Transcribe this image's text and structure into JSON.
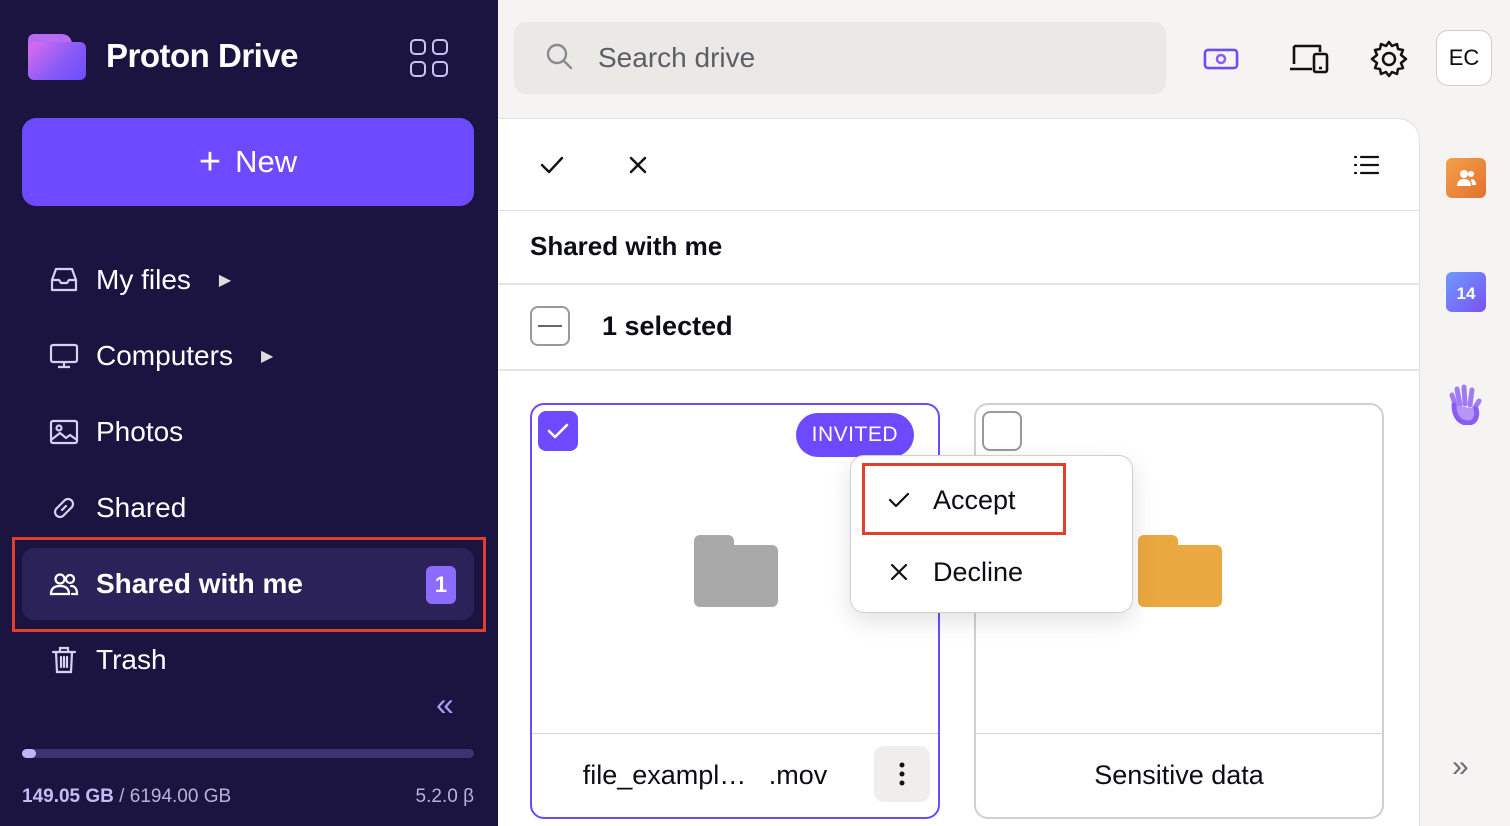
{
  "app": {
    "name": "Proton Drive"
  },
  "sidebar": {
    "new_button": {
      "plus": "+",
      "label": "New"
    },
    "items": [
      {
        "label": "My files",
        "icon": "inbox-icon",
        "has_caret": true
      },
      {
        "label": "Computers",
        "icon": "monitor-icon",
        "has_caret": true
      },
      {
        "label": "Photos",
        "icon": "image-icon",
        "has_caret": false
      },
      {
        "label": "Shared",
        "icon": "link-icon",
        "has_caret": false
      },
      {
        "label": "Shared with me",
        "icon": "users-icon",
        "active": true,
        "badge": "1"
      },
      {
        "label": "Trash",
        "icon": "trash-icon",
        "has_caret": false
      }
    ],
    "collapse_glyph": "«",
    "storage": {
      "used": "149.05 GB",
      "separator": " / ",
      "total": "6194.00 GB",
      "fraction_used": 0.024
    },
    "version": "5.2.0 β"
  },
  "topbar": {
    "search_placeholder": "Search drive",
    "icons": [
      "upgrade-money-icon",
      "devices-icon",
      "settings-gear-icon"
    ],
    "avatar_initials": "EC"
  },
  "main": {
    "section_title": "Shared with me",
    "selection_text": "1 selected",
    "cards": [
      {
        "name": "file_exampl…   .mov",
        "badge": "INVITED",
        "selected": true,
        "folder_color": "#a9a9a9"
      },
      {
        "name": "Sensitive data",
        "selected": false,
        "folder_color": "#eaa840"
      }
    ]
  },
  "context_menu": {
    "items": [
      {
        "label": "Accept",
        "icon": "check-icon"
      },
      {
        "label": "Decline",
        "icon": "close-icon"
      }
    ]
  },
  "right_rail": {
    "icons": [
      "contacts-icon",
      "calendar-icon",
      "wave-hand-icon"
    ],
    "calendar_day": "14",
    "expand_glyph": "»"
  },
  "colors": {
    "sidebar_bg": "#1b1340",
    "accent": "#6d4aff",
    "highlight_border": "#e0412e"
  }
}
